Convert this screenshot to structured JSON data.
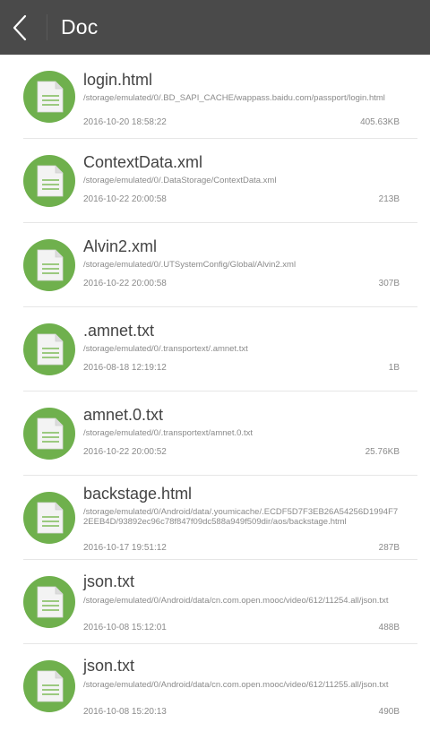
{
  "header": {
    "title": "Doc",
    "background": "#4a4a4a"
  },
  "files": [
    {
      "name": "login.html",
      "path": "/storage/emulated/0/.BD_SAPI_CACHE/wappass.baidu.com/passport/login.html",
      "date": "2016-10-20 18:58:22",
      "size": "405.63KB"
    },
    {
      "name": "ContextData.xml",
      "path": "/storage/emulated/0/.DataStorage/ContextData.xml",
      "date": "2016-10-22 20:00:58",
      "size": "213B"
    },
    {
      "name": "Alvin2.xml",
      "path": "/storage/emulated/0/.UTSystemConfig/Global/Alvin2.xml",
      "date": "2016-10-22 20:00:58",
      "size": "307B"
    },
    {
      "name": ".amnet.txt",
      "path": "/storage/emulated/0/.transportext/.amnet.txt",
      "date": "2016-08-18 12:19:12",
      "size": "1B"
    },
    {
      "name": "amnet.0.txt",
      "path": "/storage/emulated/0/.transportext/amnet.0.txt",
      "date": "2016-10-22 20:00:52",
      "size": "25.76KB"
    },
    {
      "name": "backstage.html",
      "path": "/storage/emulated/0/Android/data/.youmicache/.ECDF5D7F3EB26A54256D1994F72EEB4D/93892ec96c78f847f09dc588a949f509dir/aos/backstage.html",
      "date": "2016-10-17 19:51:12",
      "size": "287B"
    },
    {
      "name": "json.txt",
      "path": "/storage/emulated/0/Android/data/cn.com.open.mooc/video/612/11254.all/json.txt",
      "date": "2016-10-08 15:12:01",
      "size": "488B"
    },
    {
      "name": "json.txt",
      "path": "/storage/emulated/0/Android/data/cn.com.open.mooc/video/612/11255.all/json.txt",
      "date": "2016-10-08 15:20:13",
      "size": "490B"
    }
  ],
  "icon": {
    "name": "document-icon",
    "circle_color": "#6fb04d",
    "page_color": "#f2f2f2"
  }
}
